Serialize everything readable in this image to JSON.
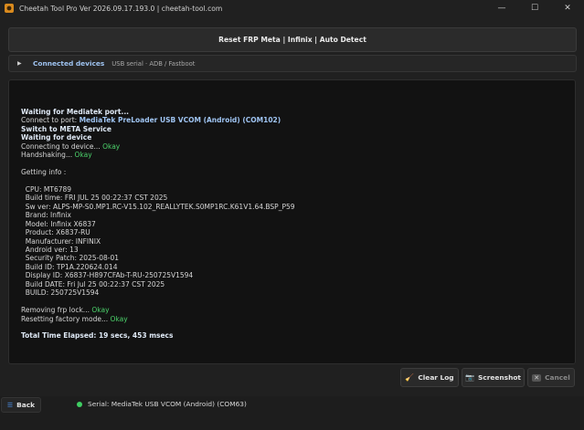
{
  "window": {
    "title": "Cheetah Tool Pro Ver 2026.09.17.193.0 | cheetah-tool.com",
    "controls": [
      "—",
      "☐",
      "✕"
    ]
  },
  "header": {
    "title": "Reset FRP Meta  |  Infinix  |  Auto Detect"
  },
  "devices": {
    "label": "Connected devices",
    "modes": "USB serial · ADB / Fastboot"
  },
  "log": {
    "lines": [
      [
        {
          "t": "Waiting for Mediatek port...",
          "s": "b"
        }
      ],
      [
        {
          "t": "Connect to port: ",
          "s": ""
        },
        {
          "t": "MediaTek PreLoader USB VCOM (Android) (COM102)",
          "s": "blue"
        }
      ],
      [
        {
          "t": "Switch to META Service",
          "s": "b"
        }
      ],
      [
        {
          "t": "Waiting for device",
          "s": "b"
        }
      ],
      [
        {
          "t": "Connecting to device... ",
          "s": ""
        },
        {
          "t": "Okay",
          "s": "ok"
        }
      ],
      [
        {
          "t": "Handshaking... ",
          "s": ""
        },
        {
          "t": "Okay",
          "s": "ok"
        }
      ],
      [
        {
          "t": "",
          "s": ""
        }
      ],
      [
        {
          "t": "Getting info :",
          "s": ""
        }
      ],
      [
        {
          "t": "",
          "s": ""
        }
      ],
      [
        {
          "t": "  CPU: MT6789",
          "s": ""
        }
      ],
      [
        {
          "t": "  Build time: FRI JUL 25 00:22:37 CST 2025",
          "s": ""
        }
      ],
      [
        {
          "t": "  Sw ver: ALPS-MP-S0.MP1.RC-V15.102_REALLYTEK.S0MP1RC.K61V1.64.BSP_P59",
          "s": ""
        }
      ],
      [
        {
          "t": "  Brand: Infinix",
          "s": ""
        }
      ],
      [
        {
          "t": "  Model: Infinix X6837",
          "s": ""
        }
      ],
      [
        {
          "t": "  Product: X6837-RU",
          "s": ""
        }
      ],
      [
        {
          "t": "  Manufacturer: INFINIX",
          "s": ""
        }
      ],
      [
        {
          "t": "  Android ver: 13",
          "s": ""
        }
      ],
      [
        {
          "t": "  Security Patch: 2025-08-01",
          "s": ""
        }
      ],
      [
        {
          "t": "  Build ID: TP1A.220624.014",
          "s": ""
        }
      ],
      [
        {
          "t": "  Display ID: X6837-H897CFAb-T-RU-250725V1594",
          "s": ""
        }
      ],
      [
        {
          "t": "  Build DATE: Fri Jul 25 00:22:37 CST 2025",
          "s": ""
        }
      ],
      [
        {
          "t": "  BUILD: 250725V1594",
          "s": ""
        }
      ],
      [
        {
          "t": "",
          "s": ""
        }
      ],
      [
        {
          "t": "Removing frp lock... ",
          "s": ""
        },
        {
          "t": "Okay",
          "s": "ok"
        }
      ],
      [
        {
          "t": "Resetting factory mode... ",
          "s": ""
        },
        {
          "t": "Okay",
          "s": "ok"
        }
      ],
      [
        {
          "t": "",
          "s": ""
        }
      ],
      [
        {
          "t": "Total Time Elapsed: 19 secs, 453 msecs",
          "s": "b"
        }
      ]
    ]
  },
  "buttons": {
    "clear_log": "Clear Log",
    "screenshot": "Screenshot",
    "cancel": "Cancel",
    "back": "Back"
  },
  "status": {
    "text": "Serial: MediaTek USB VCOM (Android) (COM63)",
    "color": "#3fcf63"
  },
  "colors": {
    "accent_blue": "#9fc4f2",
    "ok_green": "#4cd26b"
  }
}
